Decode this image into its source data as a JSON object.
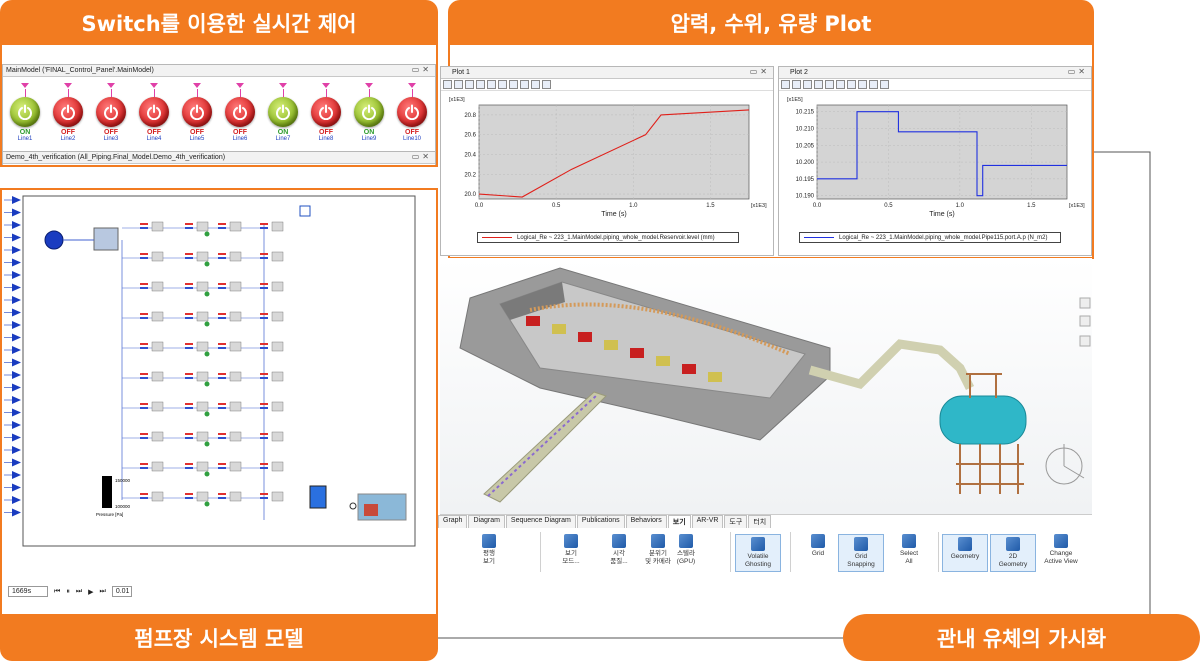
{
  "banners": {
    "switch_control": "Switch를 이용한 실시간 제어",
    "pressure_plot": "압력, 수위, 유량 Plot",
    "pump_model": "펌프장 시스템 모델",
    "visualization": "관내 유체의 가시화"
  },
  "main_model": {
    "title": "MainModel ('FINAL_Control_Panel'.MainModel)",
    "switches": [
      {
        "state": "ON",
        "label": "Line1"
      },
      {
        "state": "OFF",
        "label": "Line2"
      },
      {
        "state": "OFF",
        "label": "Line3"
      },
      {
        "state": "OFF",
        "label": "Line4"
      },
      {
        "state": "OFF",
        "label": "Line5"
      },
      {
        "state": "OFF",
        "label": "Line6"
      },
      {
        "state": "ON",
        "label": "Line7"
      },
      {
        "state": "OFF",
        "label": "Line8"
      },
      {
        "state": "ON",
        "label": "Line9"
      },
      {
        "state": "OFF",
        "label": "Line10"
      }
    ]
  },
  "demo_model": {
    "title": "Demo_4th_verification (All_Piping.Final_Model.Demo_4th_verification)",
    "gauge_top": "150000",
    "gauge_bottom": "100000",
    "gauge_label": "Pressure [Pa]",
    "time_value": "1669s",
    "step_value": "0.01"
  },
  "plot1": {
    "title": "Plot 1",
    "legend": "Logical_Re ~ 223_1.MainModel.piping_whole_model.Reservoir.level (mm)"
  },
  "plot2": {
    "title": "Plot 2",
    "legend": "Logical_Re ~ 223_1.MainModel.piping_whole_model.Pipe115.port.A.p (N_m2)"
  },
  "chart_data": [
    {
      "type": "line",
      "title": "",
      "xlabel": "Time (s)",
      "x_multiplier": "[x1E3]",
      "y_multiplier": "[x1E3]",
      "xlim": [
        0,
        1.75
      ],
      "ylim": [
        19.95,
        20.9
      ],
      "xticks": [
        "0.0",
        "0.5",
        "1.0",
        "1.5"
      ],
      "yticks": [
        "20.0",
        "20.2",
        "20.4",
        "20.6",
        "20.8"
      ],
      "grid": true,
      "series": [
        {
          "name": "Logical_Re ~ 223_1.MainModel.piping_whole_model.Reservoir.level (mm)",
          "color": "#e0201a",
          "x": [
            0,
            0.28,
            0.6,
            1.08,
            1.18,
            1.75
          ],
          "y": [
            20.0,
            19.97,
            20.25,
            20.6,
            20.8,
            20.85
          ]
        }
      ]
    },
    {
      "type": "line",
      "title": "",
      "xlabel": "Time (s)",
      "x_multiplier": "[x1E3]",
      "y_multiplier": "[x1E5]",
      "xlim": [
        0,
        1.75
      ],
      "ylim": [
        10.189,
        10.217
      ],
      "xticks": [
        "0.0",
        "0.5",
        "1.0",
        "1.5"
      ],
      "yticks": [
        "10.190",
        "10.195",
        "10.200",
        "10.205",
        "10.210",
        "10.215"
      ],
      "grid": true,
      "series": [
        {
          "name": "Logical_Re ~ 223_1.MainModel.piping_whole_model.Pipe115.port.A.p (N_m2)",
          "color": "#2030e0",
          "x": [
            0,
            0.28,
            0.28,
            0.57,
            0.57,
            1.12,
            1.12,
            1.16,
            1.16,
            1.75
          ],
          "y": [
            10.195,
            10.195,
            10.215,
            10.215,
            10.209,
            10.209,
            10.19,
            10.19,
            10.199,
            10.199
          ]
        }
      ]
    }
  ],
  "ribbon": {
    "tabs": [
      "Graph",
      "Diagram",
      "Sequence Diagram",
      "Publications",
      "Behaviors",
      "보기",
      "AR-VR",
      "도구",
      "터치"
    ],
    "buttons": [
      {
        "label": "평행\n보기",
        "icon": "view-cube-icon"
      },
      {
        "label": "보기\n모드...",
        "icon": "view-mode-icon"
      },
      {
        "label": "시각\n품질...",
        "icon": "visual-quality-icon"
      },
      {
        "label": "분위기\n및 카메라",
        "icon": "camera-icon"
      },
      {
        "label": "스텔라\n(GPU)",
        "icon": "gpu-icon"
      },
      {
        "label": "Volatile\nGhosting",
        "icon": "ghosting-icon"
      },
      {
        "label": "Grid",
        "icon": "grid-icon"
      },
      {
        "label": "Grid\nSnapping",
        "icon": "grid-snapping-icon"
      },
      {
        "label": "Select\nAll",
        "icon": "select-all-icon"
      },
      {
        "label": "Geometry",
        "icon": "geometry-icon"
      },
      {
        "label": "2D\nGeometry",
        "icon": "2d-geometry-icon"
      },
      {
        "label": "Change\nActive View",
        "icon": "change-view-icon"
      }
    ]
  },
  "colors": {
    "accent": "#f27b20",
    "on": "#86b31b",
    "off": "#d71f1f"
  }
}
